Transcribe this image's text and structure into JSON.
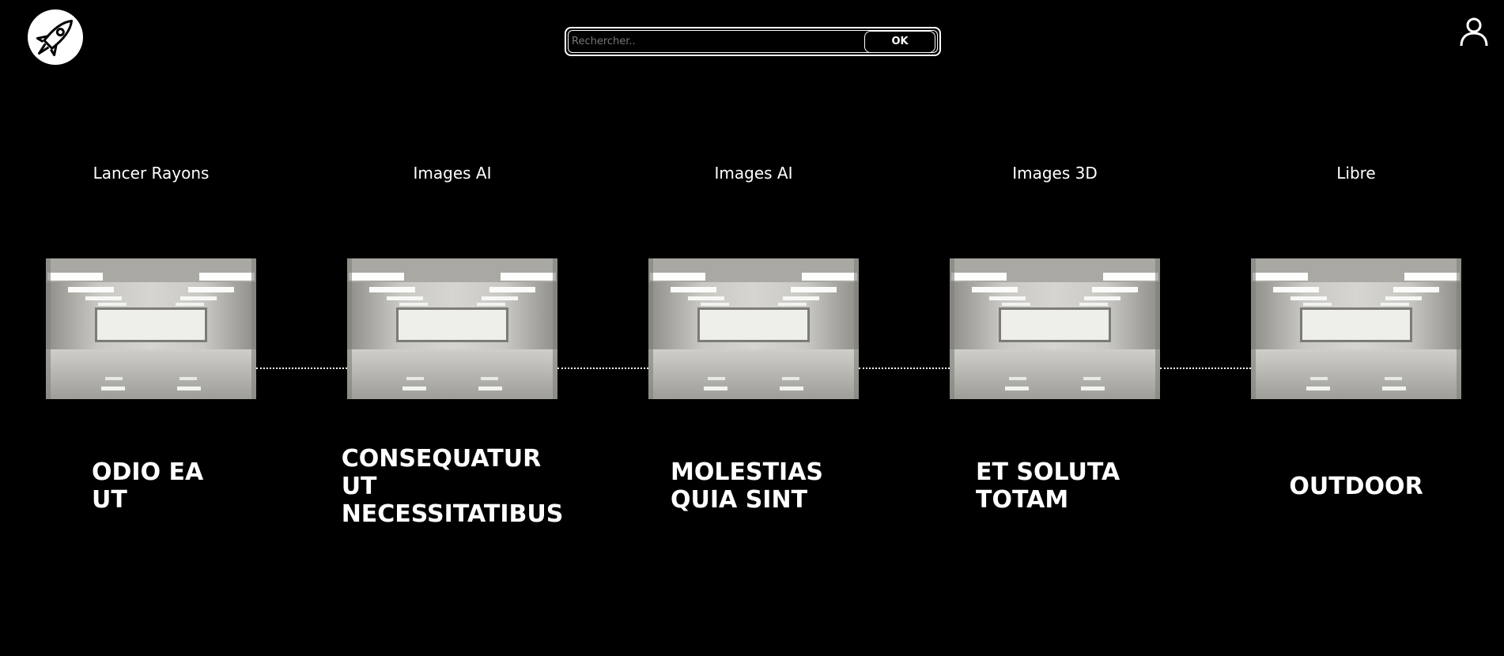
{
  "header": {
    "logo": "rocket-logo",
    "search": {
      "placeholder": "Rechercher..",
      "value": "",
      "button_label": "OK"
    },
    "user_icon": "user-icon"
  },
  "timeline": [
    {
      "category": "Lancer Rayons",
      "title": "ODIO EA UT"
    },
    {
      "category": "Images AI",
      "title": "CONSEQUATUR UT NECESSITATIBUS"
    },
    {
      "category": "Images AI",
      "title": "MOLESTIAS QUIA SINT"
    },
    {
      "category": "Images 3D",
      "title": "ET SOLUTA TOTAM"
    },
    {
      "category": "Libre",
      "title": "OUTDOOR"
    }
  ],
  "colors": {
    "background": "#000000",
    "foreground": "#ffffff"
  }
}
